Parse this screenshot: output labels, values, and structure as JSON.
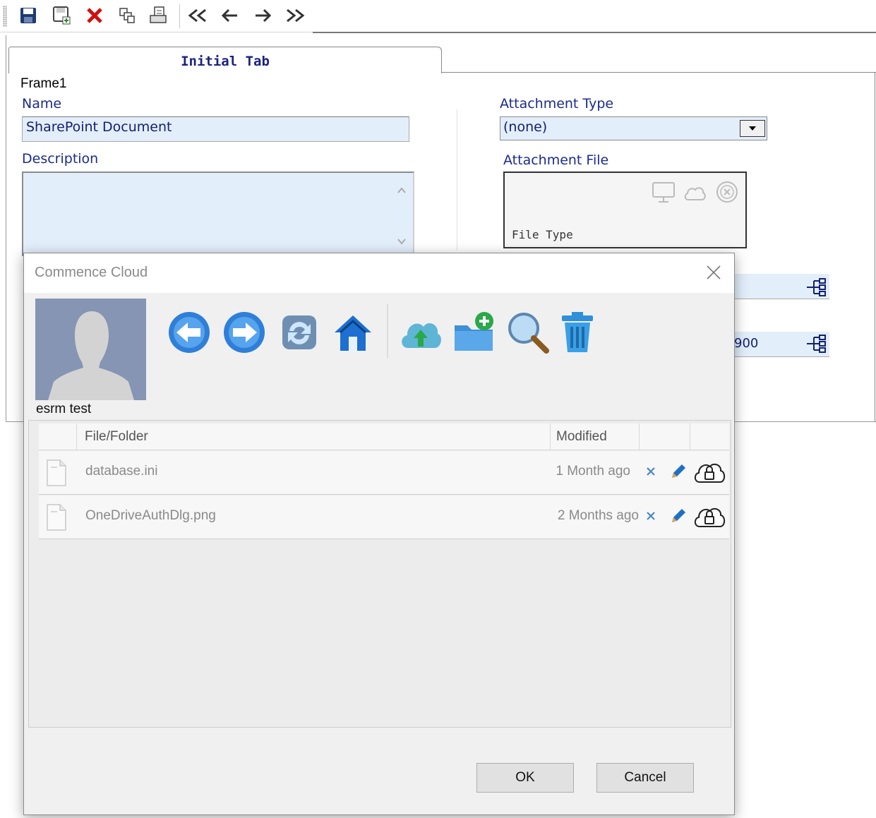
{
  "toolbar": {
    "icons": [
      "save-icon",
      "save-new-icon",
      "delete-icon",
      "copy-icon",
      "print-icon",
      "first-record-icon",
      "previous-record-icon",
      "next-record-icon",
      "last-record-icon"
    ]
  },
  "form": {
    "tab_label": "Initial Tab",
    "frame_label": "Frame1",
    "name_label": "Name",
    "name_value": "SharePoint Document",
    "description_label": "Description",
    "attachment_type_label": "Attachment Type",
    "attachment_type_value": "(none)",
    "attachment_file_label": "Attachment File",
    "file_type_label": "File Type",
    "partial_field_value": "900"
  },
  "dialog": {
    "title": "Commence Cloud",
    "user_name": "esrm test",
    "tools": [
      "back-icon",
      "forward-icon",
      "refresh-icon",
      "home-icon",
      "cloud-upload-icon",
      "new-folder-icon",
      "search-icon",
      "trash-icon"
    ],
    "columns": [
      "File/Folder",
      "Modified"
    ],
    "rows": [
      {
        "name": "database.ini",
        "modified": "1 Month ago"
      },
      {
        "name": "OneDriveAuthDlg.png",
        "modified": "2 Months ago"
      }
    ],
    "ok_label": "OK",
    "cancel_label": "Cancel"
  },
  "colors": {
    "label_blue": "#1a2b8c",
    "field_bg": "#e3eefb",
    "dialog_bg": "#f0f0f0",
    "icon_blue": "#2f7fd8"
  }
}
